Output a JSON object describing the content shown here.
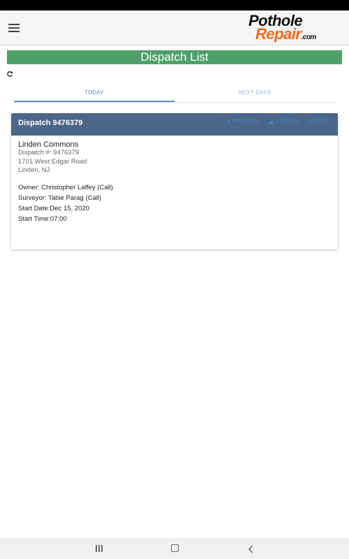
{
  "logo": {
    "line1": "Pothole",
    "line2": "Repair",
    "tld": ".com"
  },
  "title": "Dispatch List",
  "tabs": [
    {
      "label": "TODAY",
      "active": true
    },
    {
      "label": "NEXT DAYS",
      "active": false
    }
  ],
  "dispatch": {
    "header": "Dispatch 9476379",
    "site_name": "Linden Commons",
    "dispatch_no": "Dispatch #: 9476379",
    "address": "1701 West Edgar Road",
    "city": "Linden, NJ",
    "owner": "Owner: Christopher Laffey (Call)",
    "surveyor": "Surveyor: Tabie Parag (Call)",
    "start_date": "Start Date:Dec 15, 2020",
    "start_time": "Start Time:07:00",
    "actions": {
      "preview": "PREVIEW",
      "locate": "LOCATE",
      "start": "START"
    }
  },
  "colors": {
    "title_bar": "#4f9f6a",
    "card_header": "#4b6689",
    "accent": "#5a8fd0",
    "logo_orange": "#f26a1b"
  },
  "icons": {
    "menu": "hamburger-menu-icon",
    "refresh": "refresh-icon",
    "preview": "triangle-right-icon",
    "locate": "navigation-arrow-icon",
    "start": "triangle-right-icon",
    "nav_recents": "recents-icon",
    "nav_home": "home-icon",
    "nav_back": "back-icon"
  }
}
